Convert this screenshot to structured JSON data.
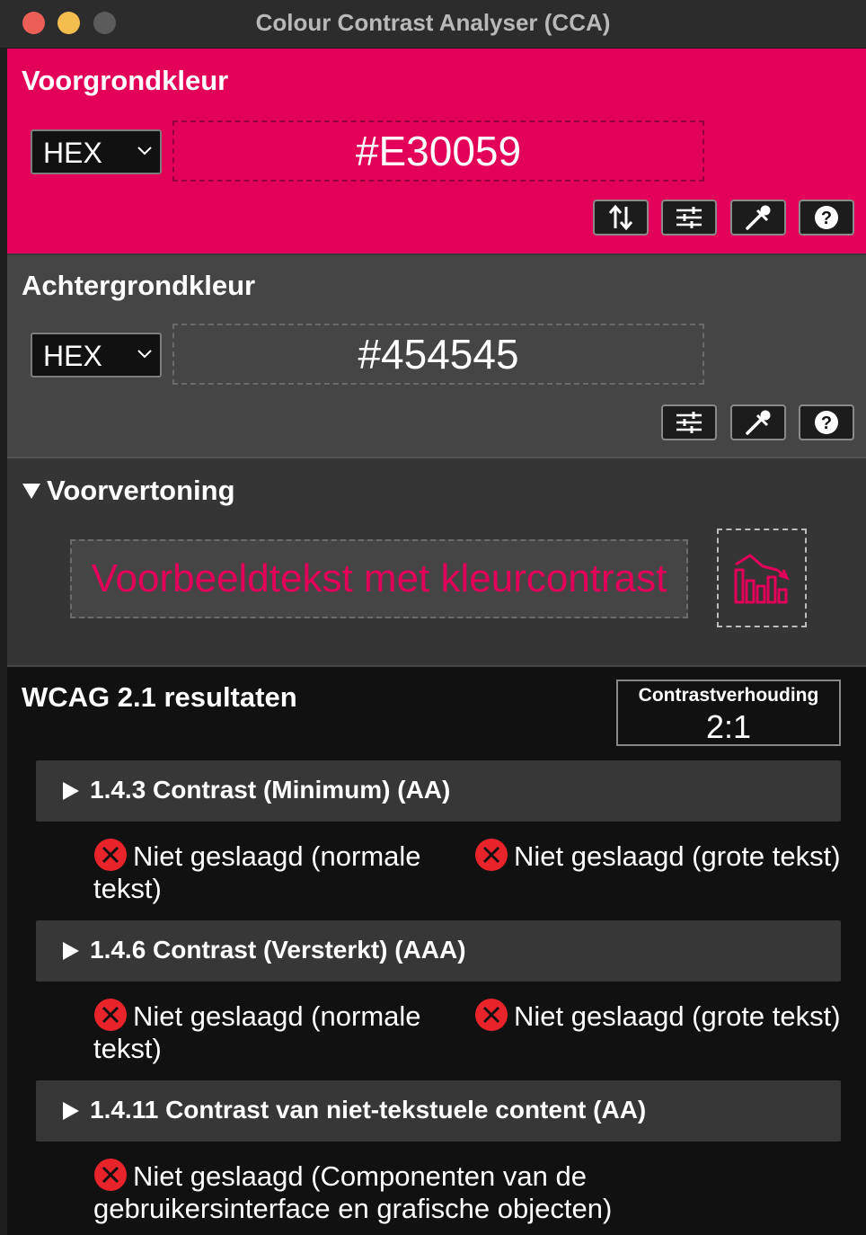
{
  "window": {
    "title": "Colour Contrast Analyser (CCA)"
  },
  "foreground": {
    "title": "Voorgrondkleur",
    "format": "HEX",
    "value": "#E30059",
    "color": "#e30059"
  },
  "background": {
    "title": "Achtergrondkleur",
    "format": "HEX",
    "value": "#454545",
    "color": "#454545"
  },
  "preview": {
    "title": "Voorvertoning",
    "sample_text": "Voorbeeldtekst met kleurcontrast"
  },
  "wcag": {
    "title": "WCAG 2.1 resultaten",
    "ratio_label": "Contrastverhouding",
    "ratio_value": "2:1",
    "criteria": [
      {
        "label": "1.4.3 Contrast (Minimum) (AA)",
        "results": [
          "Niet geslaagd (normale tekst)",
          "Niet geslaagd (grote tekst)"
        ]
      },
      {
        "label": "1.4.6 Contrast (Versterkt) (AAA)",
        "results": [
          "Niet geslaagd (normale tekst)",
          "Niet geslaagd (grote tekst)"
        ]
      },
      {
        "label": "1.4.11 Contrast van niet-tekstuele content (AA)",
        "results": [
          "Niet geslaagd (Componenten van de gebruikersinterface en grafische objecten)"
        ]
      }
    ]
  },
  "icons": {
    "swap": "swap-arrows-icon",
    "sliders": "sliders-icon",
    "eyedropper": "eyedropper-icon",
    "help": "help-icon",
    "chart": "chart-icon",
    "fail": "fail-x-icon"
  },
  "colors": {
    "fail_red": "#e8242a",
    "panel_dark": "#111111",
    "criteria_bar": "#373737"
  }
}
